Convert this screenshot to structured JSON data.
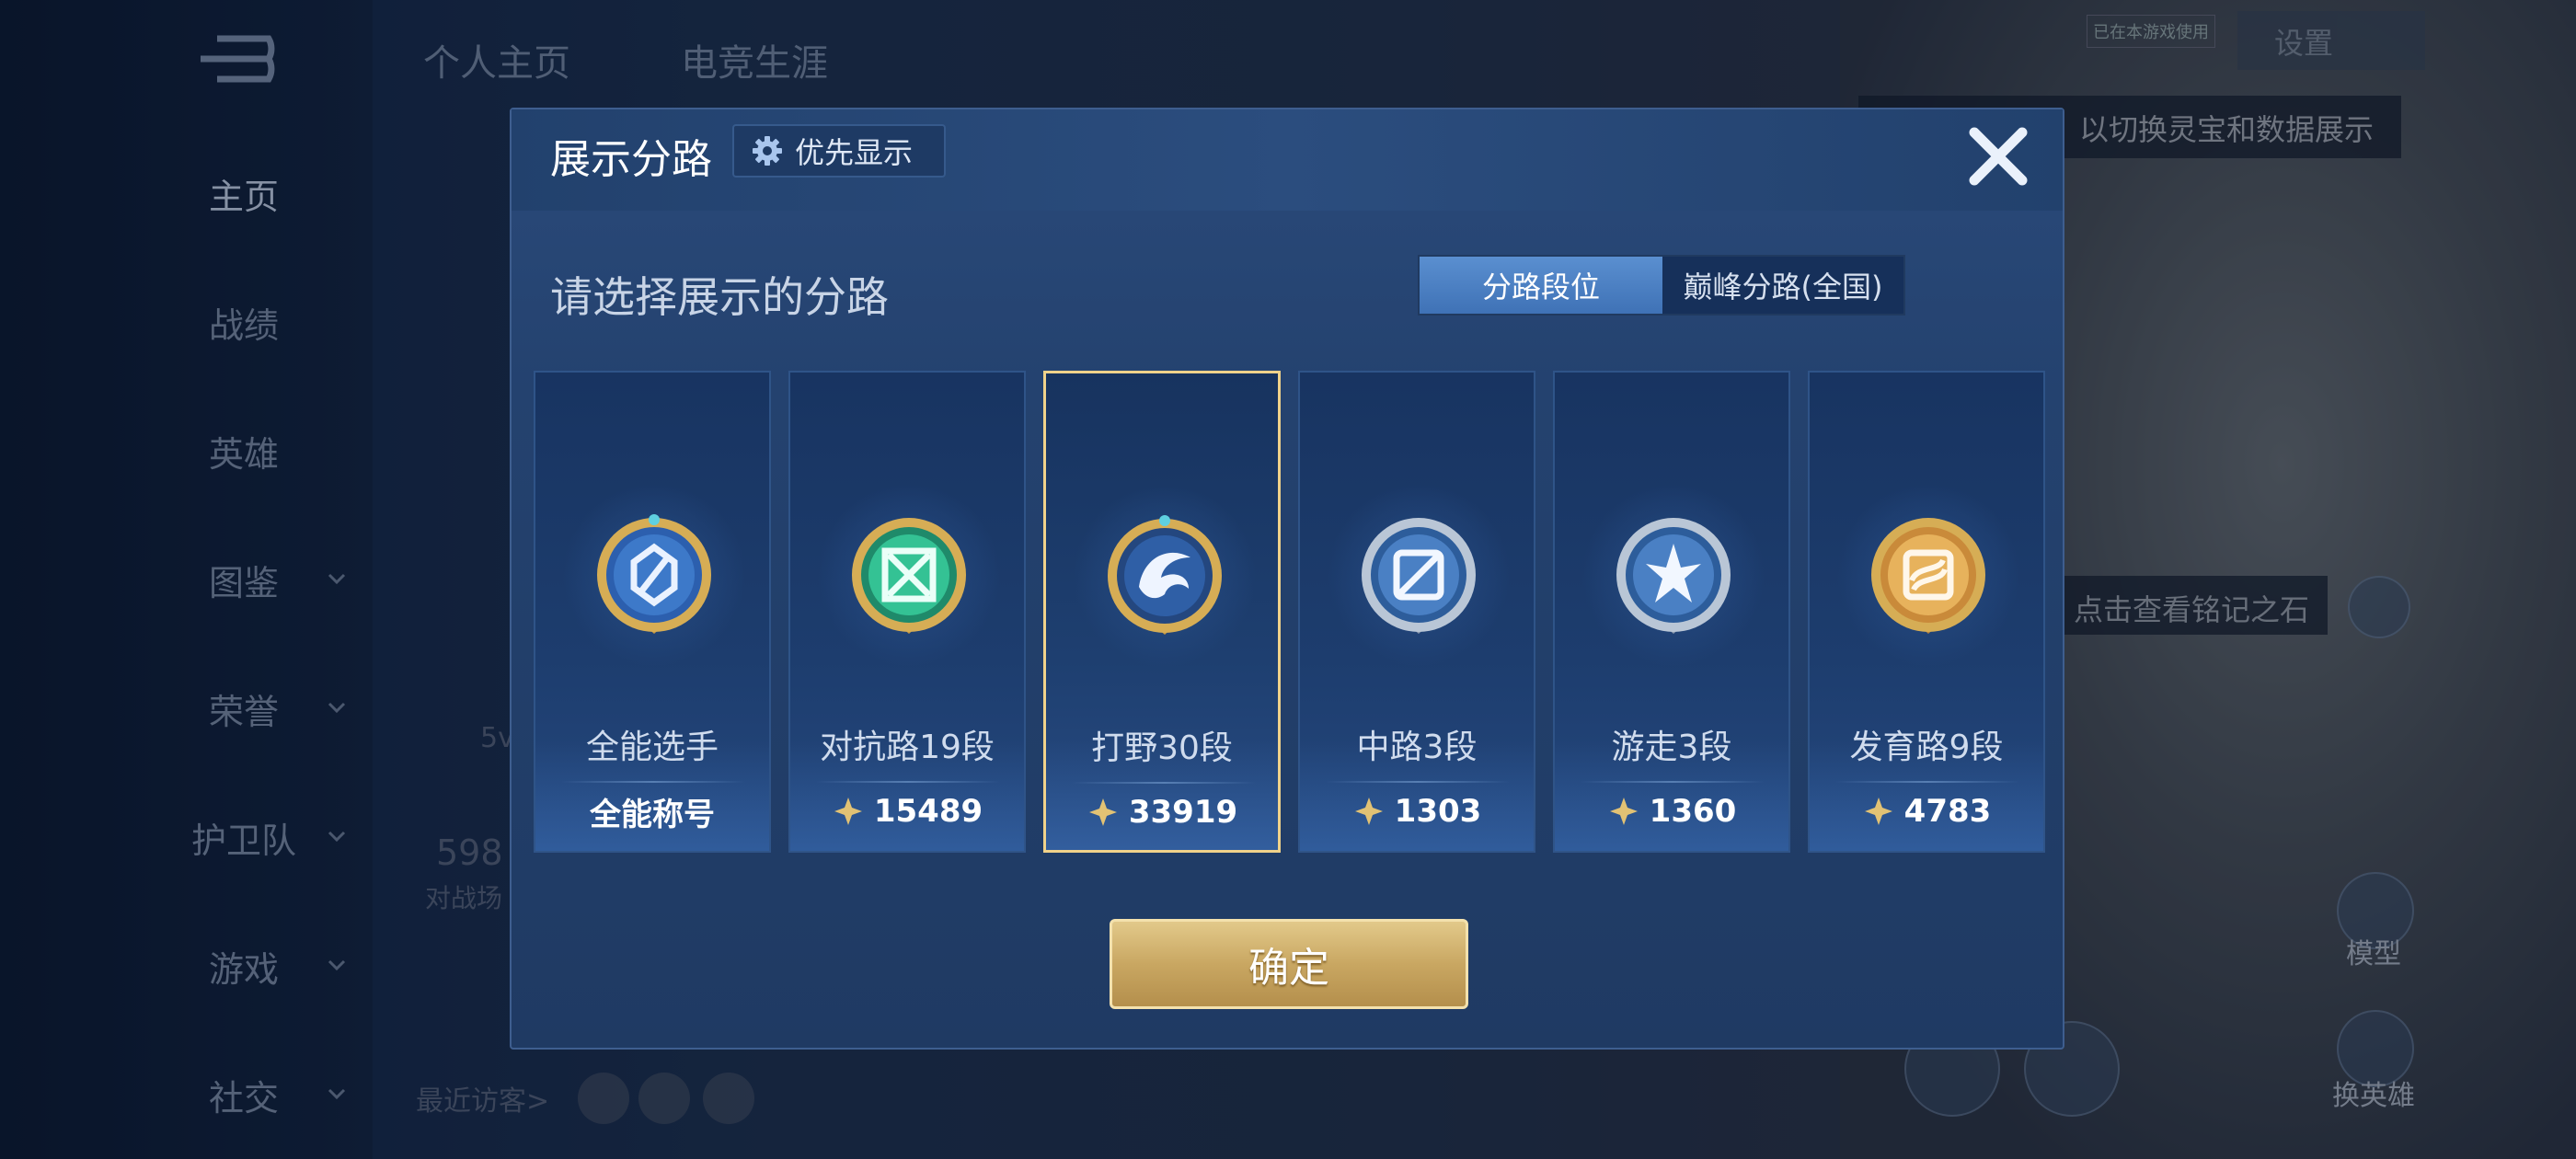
{
  "sidebar": {
    "items": [
      {
        "label": "主页",
        "active": true
      },
      {
        "label": "战绩"
      },
      {
        "label": "英雄"
      },
      {
        "label": "图鉴"
      },
      {
        "label": "荣誉"
      },
      {
        "label": "护卫队"
      },
      {
        "label": "游戏"
      },
      {
        "label": "社交"
      }
    ]
  },
  "top_tabs": [
    "个人主页",
    "电竞生涯"
  ],
  "background": {
    "visitors_label": "最近访客>",
    "partial_text_1": "598",
    "partial_text_2": "对战场",
    "partial_text_3": "5v",
    "tip_top": "以切换灵宝和数据展示",
    "tip_mid": "点击查看铭记之石",
    "tiny_tag": "已在本游戏使用",
    "settings": "设置",
    "model_btn": "模型",
    "switch_hero_btn": "换英雄"
  },
  "modal": {
    "title": "展示分路",
    "priority_label": "优先显示",
    "prompt": "请选择展示的分路",
    "segment": {
      "tab1": "分路段位",
      "tab2": "巅峰分路(全国)",
      "active": "tab1"
    },
    "cards": [
      {
        "name": "全能选手",
        "score": "全能称号",
        "badge": "all-rounder-badge-icon",
        "selected": false
      },
      {
        "name": "对抗路19段",
        "score": "15489",
        "badge": "clash-lane-badge-icon",
        "selected": false
      },
      {
        "name": "打野30段",
        "score": "33919",
        "badge": "jungle-badge-icon",
        "selected": true
      },
      {
        "name": "中路3段",
        "score": "1303",
        "badge": "mid-lane-badge-icon",
        "selected": false
      },
      {
        "name": "游走3段",
        "score": "1360",
        "badge": "roam-badge-icon",
        "selected": false
      },
      {
        "name": "发育路9段",
        "score": "4783",
        "badge": "farm-lane-badge-icon",
        "selected": false
      }
    ],
    "confirm_label": "确定"
  },
  "colors": {
    "accent_gold": "#c9a762",
    "segment_active": "#4a80c4",
    "selected_border": "#f0d28a"
  }
}
